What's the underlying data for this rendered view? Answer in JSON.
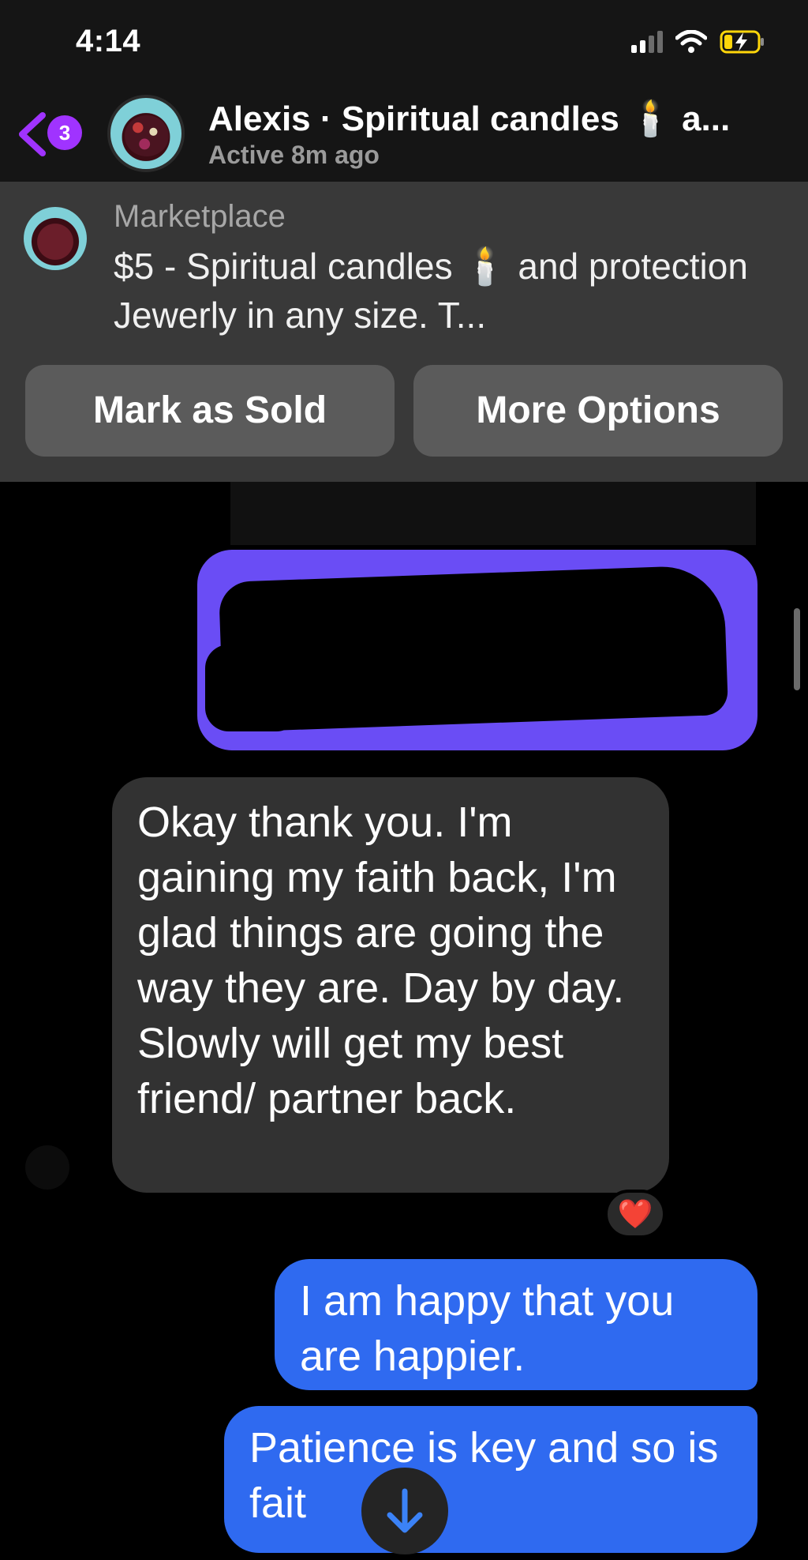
{
  "status_bar": {
    "time": "4:14"
  },
  "header": {
    "back_badge": "3",
    "contact_name": "Alexis · Spiritual candles 🕯️ a...",
    "contact_status": "Active 8m ago"
  },
  "marketplace": {
    "label": "Marketplace",
    "listing_title": "$5 - Spiritual candles 🕯️ and protection Jewerly in any size. T...",
    "mark_sold_label": "Mark as Sold",
    "more_options_label": "More Options"
  },
  "messages": [
    {
      "direction": "incoming",
      "text": "Okay thank you. I'm gaining my faith back, I'm glad things are going the way they are. Day by day. Slowly will get my best friend/ partner back.",
      "reaction": "❤️"
    },
    {
      "direction": "outgoing",
      "text": "I am happy that you are happier."
    },
    {
      "direction": "outgoing",
      "text": "Patience is key and so is  fait"
    }
  ],
  "colors": {
    "incoming_bubble": "#323232",
    "outgoing_bubble": "#2f6af0",
    "redacted_bubble": "#6a4df5",
    "accent": "#a033ff"
  },
  "icons": {
    "back": "chevron-left-icon",
    "scroll_down": "arrow-down-icon",
    "wifi": "wifi-icon",
    "battery": "battery-charging-icon"
  }
}
